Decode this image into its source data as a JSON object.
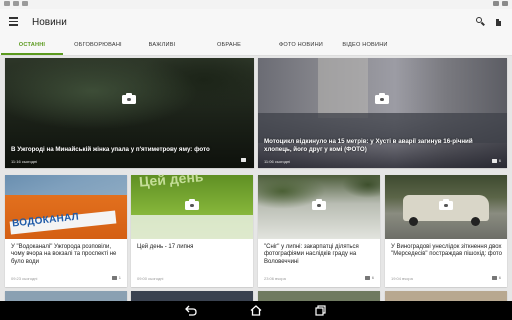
{
  "appbar": {
    "title": "Новини"
  },
  "icons": {
    "menu": "menu-icon",
    "search": "search-icon",
    "share": "share-icon",
    "camera": "camera-icon",
    "comment": "comment-icon"
  },
  "tabs": [
    {
      "label": "ОСТАННІ",
      "active": true
    },
    {
      "label": "ОБГОВОРЮВАНІ",
      "active": false
    },
    {
      "label": "ВАЖЛИВІ",
      "active": false
    },
    {
      "label": "ОБРАНЕ",
      "active": false
    },
    {
      "label": "ФОТО НОВИНИ",
      "active": false
    },
    {
      "label": "ВІДЕО НОВИНИ",
      "active": false
    }
  ],
  "featured": [
    {
      "title": "В Ужгороді на Минайській жінка упала у п'ятиметрову яму: фото",
      "time": "11:16 сьогодні",
      "comments": ""
    },
    {
      "title": "Мотоцикл відкинуло на 15 метрів: у Хусті в аварії загинув 16-річний хлопець, його друг у комі (ФОТО)",
      "time": "11:06 сьогодні",
      "comments": "6"
    }
  ],
  "cards": [
    {
      "title": "У \"Водоканалі\" Ужгорода розповіли, чому вчора на вокзалі та проспекті не було води",
      "time": "09:23 сьогодні",
      "comments": "1",
      "image_text": "ВОДОКАНАЛ"
    },
    {
      "title": "Цей день - 17 липня",
      "time": "09:00 сьогодні",
      "comments": "",
      "image_text": "Цей день"
    },
    {
      "title": "\"Сніг\" у липні: закарпатці діляться фотографіями наслідків граду на Воловеччині",
      "time": "23:06 вчора",
      "comments": "6",
      "image_text": ""
    },
    {
      "title": "У Виноградові унеслідок зіткнення двох \"Мерседесів\" постраждав пішохід: фото",
      "time": "19:04 вчора",
      "comments": "6",
      "image_text": ""
    }
  ],
  "colors": {
    "accent": "#5b9a1e",
    "navbar": "#000000"
  },
  "navbar": {
    "back": "back-icon",
    "home": "home-icon",
    "recents": "recents-icon"
  }
}
